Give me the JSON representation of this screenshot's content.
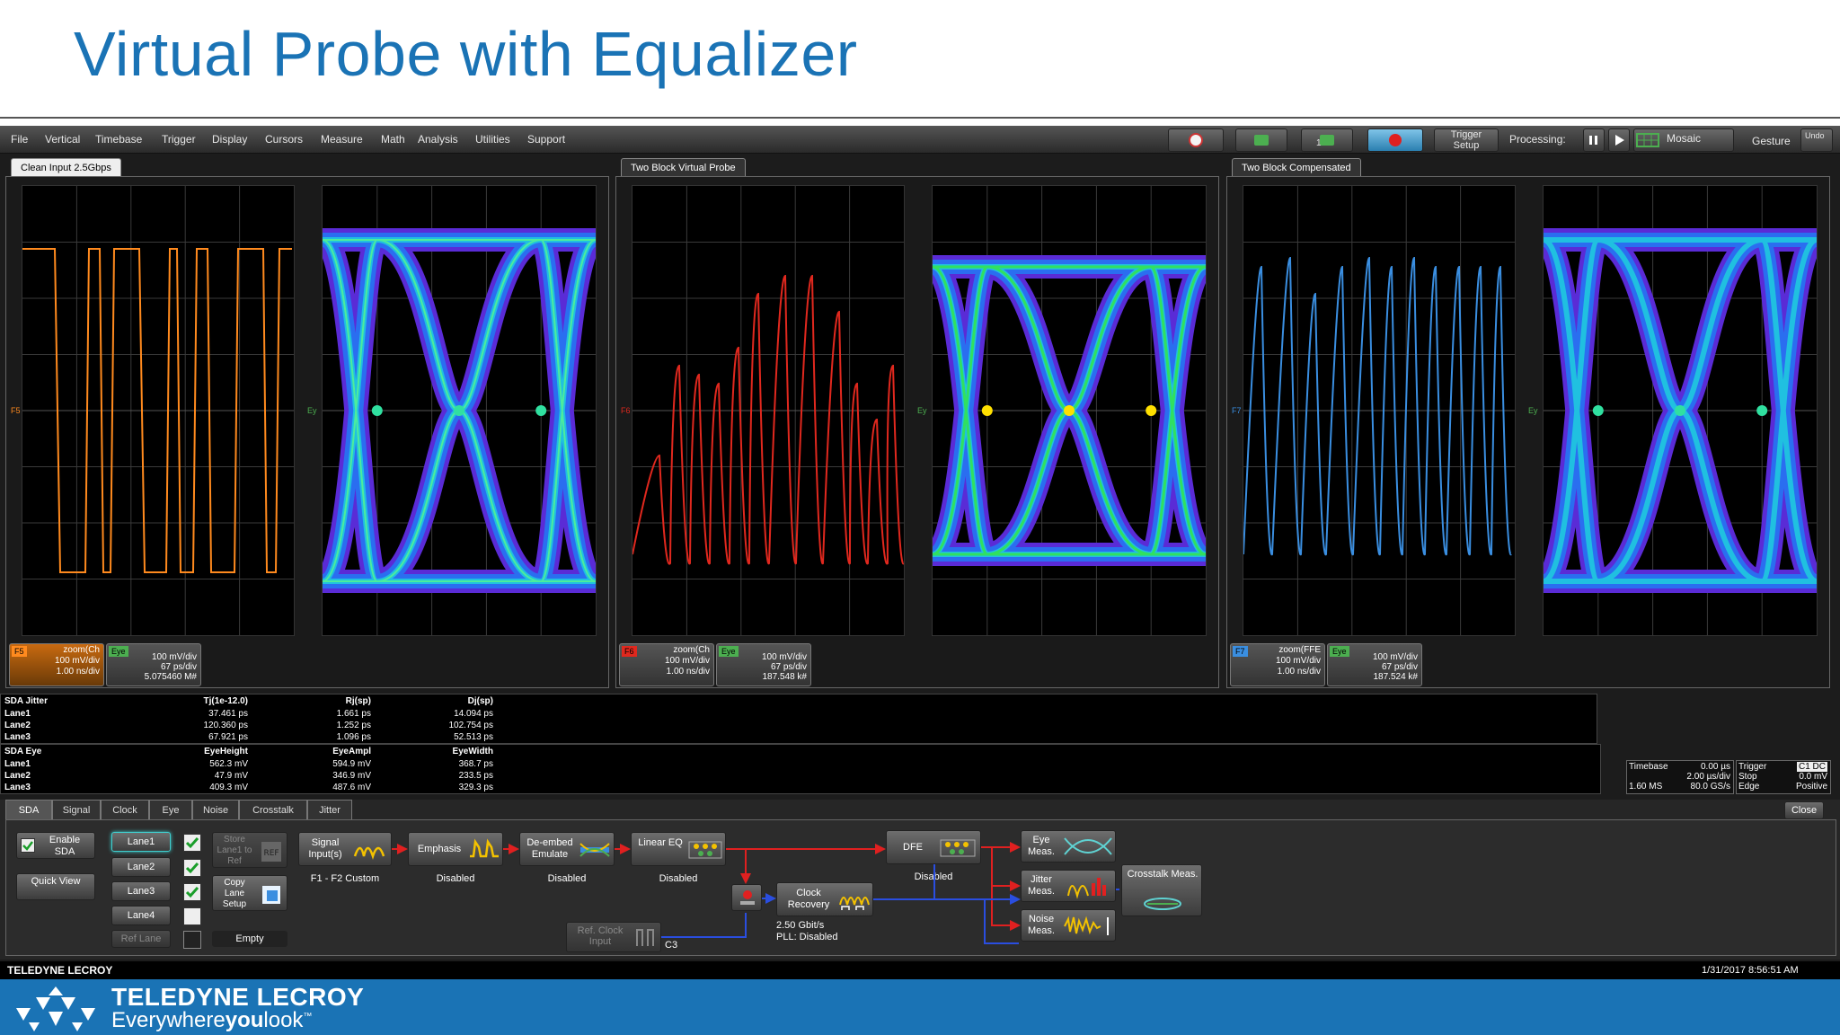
{
  "slide": {
    "title": "Virtual Probe with Equalizer"
  },
  "menu": [
    "File",
    "Vertical",
    "Timebase",
    "Trigger",
    "Display",
    "Cursors",
    "Measure",
    "Math",
    "Analysis",
    "Utilities",
    "Support"
  ],
  "toolbar": {
    "trigger_setup": "Trigger Setup",
    "processing": "Processing:",
    "mosaic": "Mosaic",
    "gesture": "Gesture",
    "undo": "Undo",
    "badge_1": "1"
  },
  "panels": [
    {
      "tab": "Clean Input 2.5Gbps",
      "wave_label": "F5",
      "eye_label": "Ey",
      "color": "#ff8a1e",
      "desc1": {
        "badge": "F5",
        "title": "zoom(Ch",
        "l1": "100 mV/div",
        "l2": "1.00 ns/div"
      },
      "desc2": {
        "badge": "Eye",
        "l1": "100 mV/div",
        "l2": "67 ps/div",
        "l3": "5.075460 M#"
      }
    },
    {
      "tab": "Two Block Virtual Probe",
      "wave_label": "F6",
      "eye_label": "Ey",
      "color": "#e0281e",
      "desc1": {
        "badge": "F6",
        "title": "zoom(Ch",
        "l1": "100 mV/div",
        "l2": "1.00 ns/div"
      },
      "desc2": {
        "badge": "Eye",
        "l1": "100 mV/div",
        "l2": "67 ps/div",
        "l3": "187.548 k#"
      }
    },
    {
      "tab": "Two Block Compensated",
      "wave_label": "F7",
      "eye_label": "Ey",
      "color": "#3a8ee0",
      "desc1": {
        "badge": "F7",
        "title": "zoom(FFE",
        "l1": "100 mV/div",
        "l2": "1.00 ns/div"
      },
      "desc2": {
        "badge": "Eye",
        "l1": "100 mV/div",
        "l2": "67 ps/div",
        "l3": "187.524 k#"
      }
    }
  ],
  "jitter_table": {
    "headers": [
      "SDA Jitter",
      "Tj(1e-12.0)",
      "Rj(sp)",
      "Dj(sp)"
    ],
    "rows": [
      [
        "Lane1",
        "37.461 ps",
        "1.661 ps",
        "14.094 ps"
      ],
      [
        "Lane2",
        "120.360 ps",
        "1.252 ps",
        "102.754 ps"
      ],
      [
        "Lane3",
        "67.921 ps",
        "1.096 ps",
        "52.513 ps"
      ]
    ]
  },
  "eye_table": {
    "headers": [
      "SDA Eye",
      "EyeHeight",
      "EyeAmpl",
      "EyeWidth"
    ],
    "rows": [
      [
        "Lane1",
        "562.3 mV",
        "594.9 mV",
        "368.7 ps"
      ],
      [
        "Lane2",
        "47.9 mV",
        "346.9 mV",
        "233.5 ps"
      ],
      [
        "Lane3",
        "409.3 mV",
        "487.6 mV",
        "329.3 ps"
      ]
    ]
  },
  "timebase": {
    "label": "Timebase",
    "delay": "0.00 µs",
    "div": "2.00 µs/div",
    "samples": "1.60 MS",
    "rate": "80.0 GS/s"
  },
  "trigger": {
    "label": "Trigger",
    "src": "C1 DC",
    "mode": "Stop",
    "level": "0.0 mV",
    "type": "Edge",
    "slope": "Positive"
  },
  "ctl_tabs": [
    "SDA",
    "Signal",
    "Clock",
    "Eye",
    "Noise",
    "Crosstalk",
    "Jitter"
  ],
  "ctl": {
    "enable_sda": "Enable SDA",
    "quick_view": "Quick View",
    "lanes": [
      "Lane1",
      "Lane2",
      "Lane3",
      "Lane4"
    ],
    "ref_lane": "Ref Lane",
    "store_lane": "Store Lane1 to Ref",
    "copy_lane": "Copy Lane Setup",
    "empty": "Empty",
    "signal_input": "Signal Input(s)",
    "signal_sub": "F1 - F2 Custom",
    "emphasis": "Emphasis",
    "emphasis_sub": "Disabled",
    "deembed": "De-embed Emulate",
    "deembed_sub": "Disabled",
    "linear_eq": "Linear EQ",
    "linear_eq_sub": "Disabled",
    "dfe": "DFE",
    "dfe_sub": "Disabled",
    "clock_recovery": "Clock Recovery",
    "clock_sub1": "2.50 Gbit/s",
    "clock_sub2": "PLL: Disabled",
    "ref_clock": "Ref. Clock Input",
    "ref_clock_sub": "C3",
    "eye_meas": "Eye Meas.",
    "jitter_meas": "Jitter Meas.",
    "noise_meas": "Noise Meas.",
    "crosstalk_meas": "Crosstalk Meas.",
    "close": "Close"
  },
  "status": {
    "brand": "TELEDYNE LECROY",
    "datetime": "1/31/2017 8:56:51 AM"
  },
  "footer": {
    "brand": "TELEDYNE LECROY",
    "tagline_a": "Everywhere",
    "tagline_b": "you",
    "tagline_c": "look",
    "tm": "™"
  }
}
